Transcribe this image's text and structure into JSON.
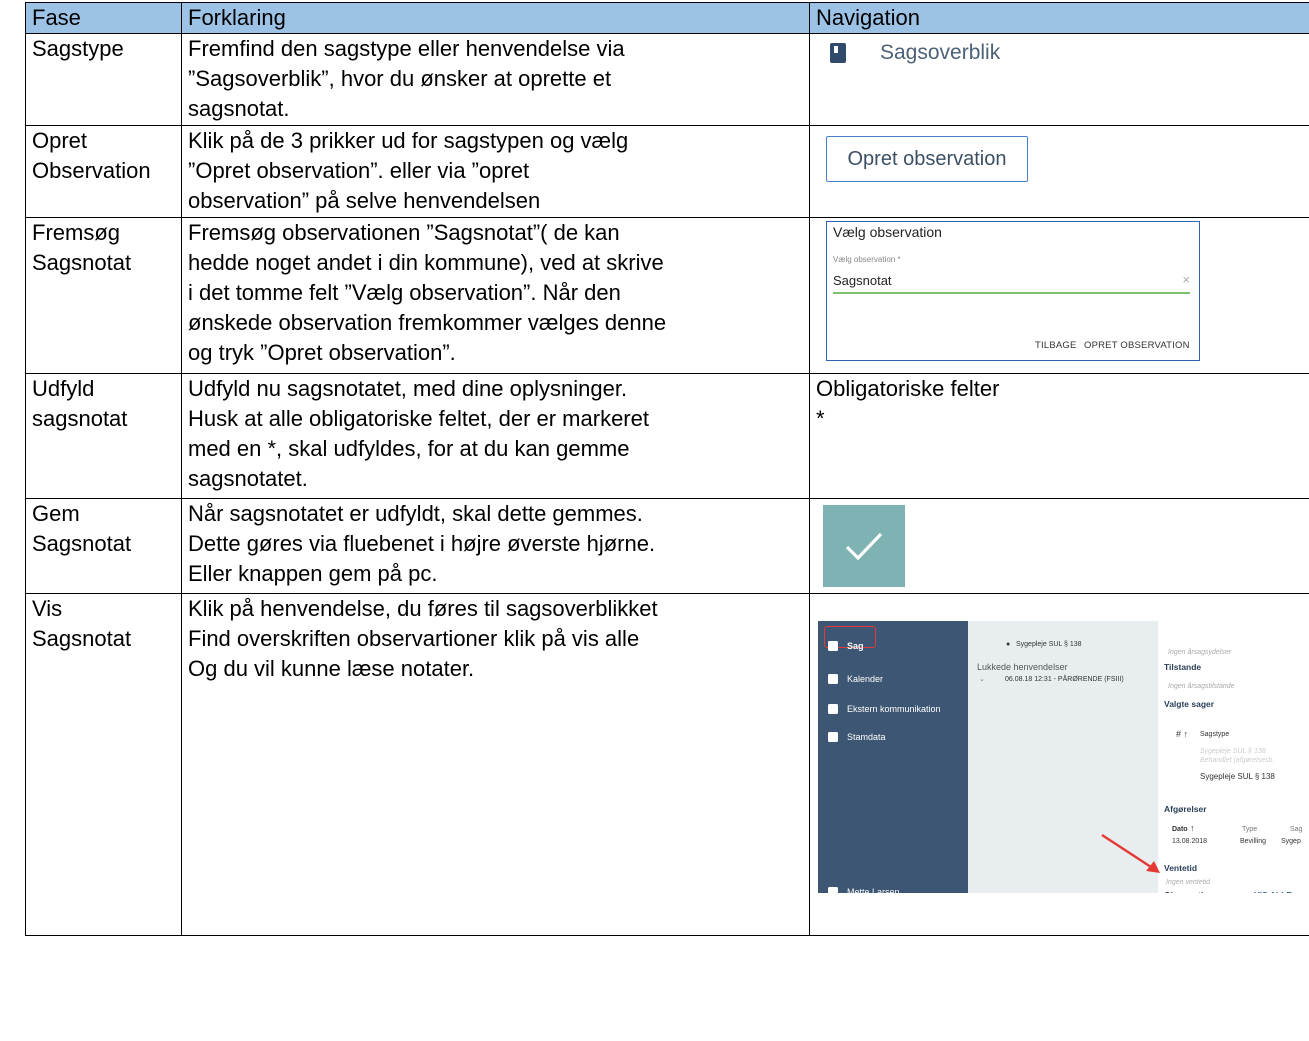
{
  "header": {
    "fase": "Fase",
    "forklaring": "Forklaring",
    "navigation": "Navigation"
  },
  "rows": [
    {
      "fase": "Sagstype",
      "forklaring": "Fremfind den sagstype eller henvendelse via\n”Sagsoverblik”, hvor du ønsker at oprette et\nsagsnotat.",
      "nav_label": "Sagsoverblik"
    },
    {
      "fase": "Opret\nObservation",
      "forklaring": "Klik på de 3 prikker ud for sagstypen og vælg\n”Opret observation”.  eller via ”opret\nobservation” på selve henvendelsen",
      "nav_button": "Opret observation"
    },
    {
      "fase": "Fremsøg\nSagsnotat",
      "forklaring": "Fremsøg observationen ”Sagsnotat”( de kan\nhedde noget andet i din kommune), ved at skrive\ni det tomme felt ”Vælg observation”. Når den\nønskede observation fremkommer vælges denne\nog tryk ”Opret observation”.",
      "dialog": {
        "title": "Vælg observation",
        "field_label": "Vælg observation *",
        "value": "Sagsnotat",
        "clear": "×",
        "back": "TILBAGE",
        "create": "OPRET OBSERVATION"
      }
    },
    {
      "fase": "Udfyld\nsagsnotat",
      "forklaring": "Udfyld nu sagsnotatet, med dine oplysninger.\nHusk at alle obligatoriske feltet, der er markeret\nmed en *, skal udfyldes, for at du kan gemme\nsagsnotatet.",
      "nav_text": "Obligatoriske felter\n*"
    },
    {
      "fase": "Gem\nSagsnotat",
      "forklaring": "Når sagsnotatet er udfyldt, skal dette gemmes.\nDette gøres via fluebenet i højre øverste hjørne.\nEller knappen gem på pc."
    },
    {
      "fase": "Vis\nSagsnotat",
      "forklaring": "Klik på henvendelse, du føres til sagsoverblikket\nFind overskriften observartioner klik på vis alle\nOg du vil kunne læse notater.",
      "screenshot": {
        "nav_items": [
          "Sag",
          "Kalender",
          "Ekstern kommunikation",
          "Stamdata"
        ],
        "user": "Mette Larsen",
        "mid_tag": "Sygepleje SUL § 138",
        "mid_heading": "Lukkede henvendelser",
        "mid_entry": "06.08.18 12:31 - PÅRØRENDE (FSIII)",
        "right": {
          "note_top": "Ingen årsagsydelser",
          "tilstande": "Tilstande",
          "tilstande_note": "Ingen årsagstilstande",
          "valgte_sager": "Valgte sager",
          "sagstype_col": "Sagstype",
          "sag_ghost_1": "Sygepleje SUL § 138",
          "sag_ghost_2": "Behandlet (afgørelsesb.",
          "sag_row": "Sygepleje SUL § 138",
          "afgorelser": "Afgørelser",
          "col_dato": "Dato",
          "col_type": "Type",
          "col_sag": "Sag",
          "afg_dato": "13.08.2018",
          "afg_type": "Bevilling",
          "afg_sag": "Sygep",
          "ventetid": "Ventetid",
          "ventetid_note": "Ingen ventetid",
          "observationer": "Observationer",
          "vis_alle": "VIS ALLE"
        }
      }
    }
  ],
  "colors": {
    "header_bg": "#9cc3e6",
    "nav_dark": "#3c5673",
    "check_tile": "#7fb3b3",
    "arrow_red": "#e53935"
  }
}
